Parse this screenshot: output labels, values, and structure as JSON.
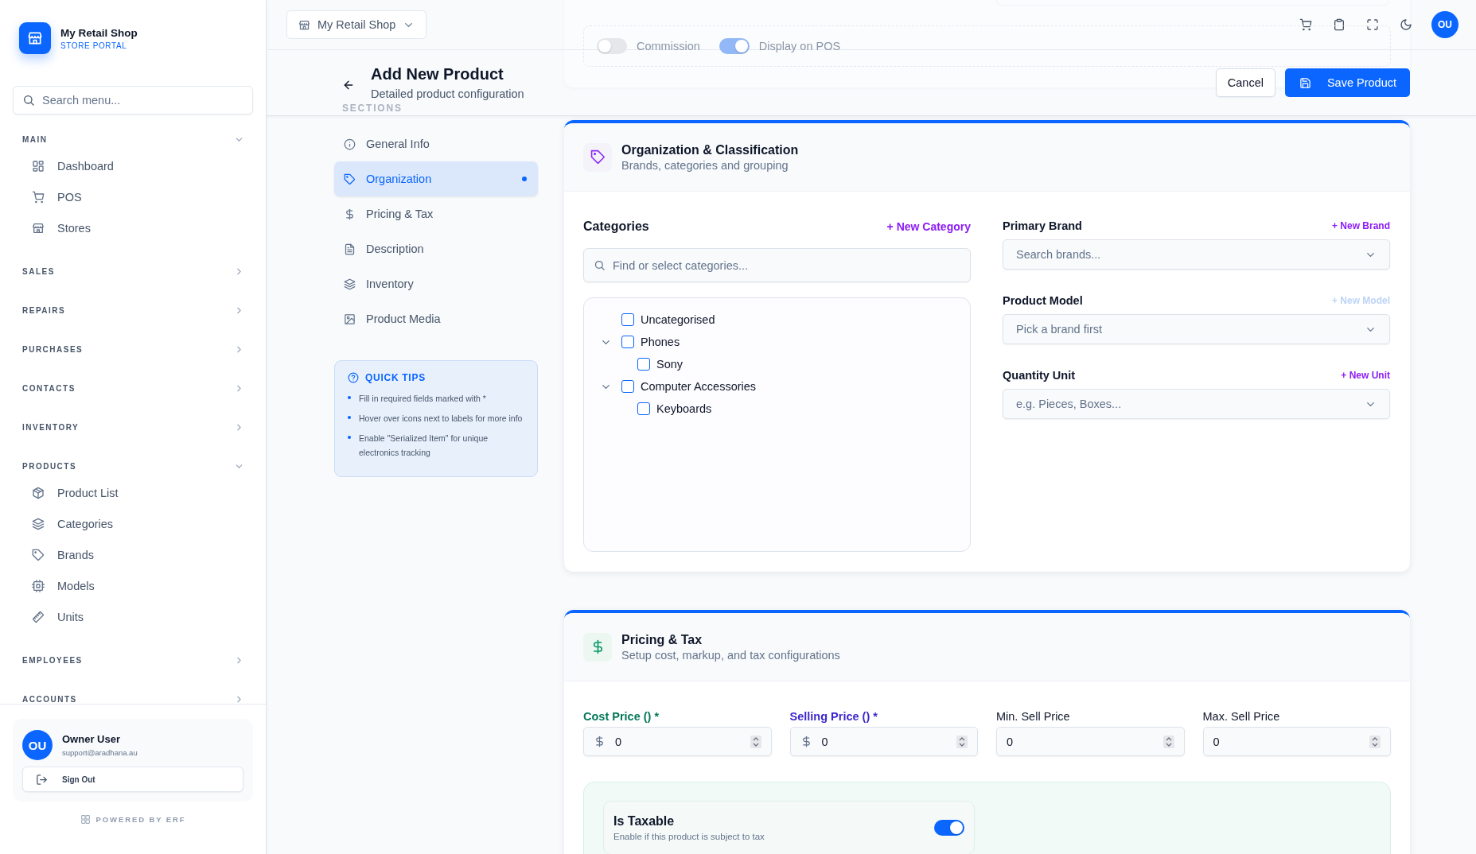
{
  "topbar": {
    "shop_selector": "My Retail Shop",
    "avatar": "OU"
  },
  "sidebar": {
    "brand": {
      "name": "My Retail Shop",
      "subtitle": "STORE PORTAL"
    },
    "search": {
      "placeholder": "Search menu..."
    },
    "groups": [
      {
        "label": "MAIN",
        "expanded": true,
        "items": [
          {
            "label": "Dashboard"
          },
          {
            "label": "POS"
          },
          {
            "label": "Stores"
          }
        ]
      },
      {
        "label": "SALES",
        "expanded": false
      },
      {
        "label": "REPAIRS",
        "expanded": false
      },
      {
        "label": "PURCHASES",
        "expanded": false
      },
      {
        "label": "CONTACTS",
        "expanded": false
      },
      {
        "label": "INVENTORY",
        "expanded": false
      },
      {
        "label": "PRODUCTS",
        "expanded": true,
        "items": [
          {
            "label": "Product List"
          },
          {
            "label": "Categories"
          },
          {
            "label": "Brands"
          },
          {
            "label": "Models"
          },
          {
            "label": "Units"
          }
        ]
      },
      {
        "label": "EMPLOYEES",
        "expanded": false
      },
      {
        "label": "ACCOUNTS",
        "expanded": false
      }
    ],
    "user": {
      "initials": "OU",
      "name": "Owner User",
      "email": "support@aradhana.au"
    },
    "sign_out": "Sign Out",
    "footer": "POWERED BY ERF"
  },
  "background_card": {
    "toggles": [
      {
        "label": "Commission",
        "on": false
      },
      {
        "label": "Display on POS",
        "on": true
      }
    ]
  },
  "page": {
    "title": "Add New Product",
    "subtitle": "Detailed product configuration",
    "cancel": "Cancel",
    "save": "Save Product"
  },
  "sections": {
    "heading": "SECTIONS",
    "items": [
      {
        "label": "General Info",
        "selected": false
      },
      {
        "label": "Organization",
        "selected": true
      },
      {
        "label": "Pricing & Tax",
        "selected": false
      },
      {
        "label": "Description",
        "selected": false
      },
      {
        "label": "Inventory",
        "selected": false
      },
      {
        "label": "Product Media",
        "selected": false
      }
    ]
  },
  "quick_tips": {
    "title": "QUICK TIPS",
    "tips": [
      "Fill in required fields marked with *",
      "Hover over icons next to labels for more info",
      "Enable \"Serialized Item\" for unique electronics tracking"
    ]
  },
  "organization": {
    "title": "Organization & Classification",
    "subtitle": "Brands, categories and grouping",
    "categories": {
      "title": "Categories",
      "new_link": "+ New Category",
      "search_placeholder": "Find or select categories...",
      "tree": [
        {
          "label": "Uncategorised",
          "checked": false
        },
        {
          "label": "Phones",
          "checked": false,
          "expanded": true,
          "children": [
            {
              "label": "Sony",
              "checked": false
            }
          ]
        },
        {
          "label": "Computer Accessories",
          "checked": false,
          "expanded": true,
          "children": [
            {
              "label": "Keyboards",
              "checked": false
            }
          ]
        }
      ]
    },
    "fields": [
      {
        "label": "Primary Brand",
        "link": "+ New Brand",
        "disabled": false,
        "placeholder": "Search brands..."
      },
      {
        "label": "Product Model",
        "link": "+ New Model",
        "disabled": true,
        "placeholder": "Pick a brand first"
      },
      {
        "label": "Quantity Unit",
        "link": "+ New Unit",
        "disabled": false,
        "placeholder": "e.g. Pieces, Boxes..."
      }
    ]
  },
  "pricing": {
    "title": "Pricing & Tax",
    "subtitle": "Setup cost, markup, and tax configurations",
    "fields": [
      {
        "label": "Cost Price () *",
        "required": true,
        "color": "#047857",
        "currency": true,
        "value": "0"
      },
      {
        "label": "Selling Price () *",
        "required": true,
        "color": "#3b28cc",
        "currency": true,
        "value": "0"
      },
      {
        "label": "Min. Sell Price",
        "required": false,
        "currency": false,
        "value": "0"
      },
      {
        "label": "Max. Sell Price",
        "required": false,
        "currency": false,
        "value": "0"
      }
    ],
    "taxable": {
      "label": "Is Taxable",
      "description": "Enable if this product is subject to tax",
      "on": true
    }
  }
}
